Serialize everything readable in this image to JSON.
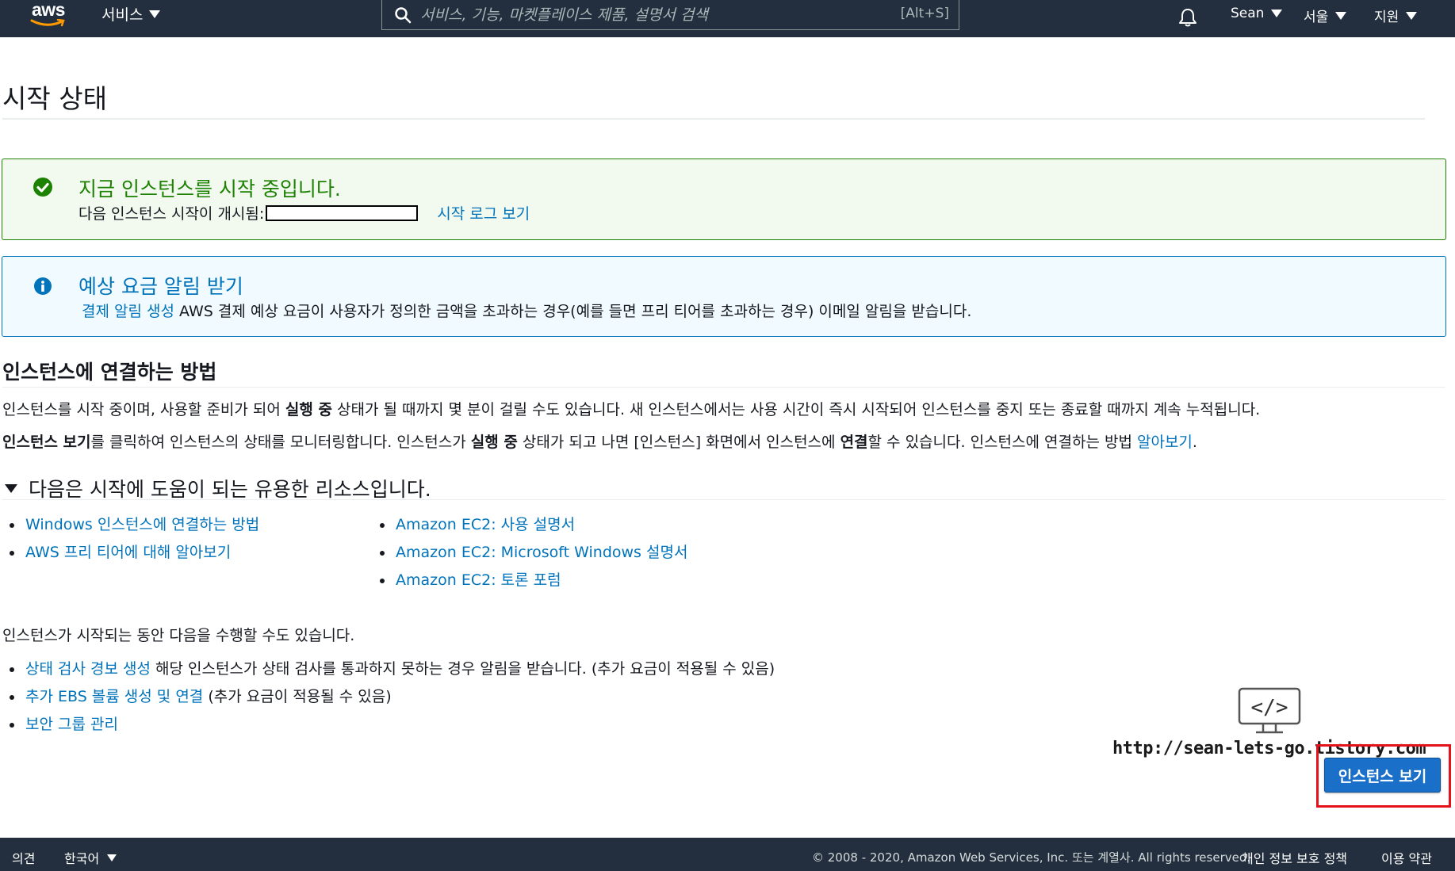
{
  "topnav": {
    "logo_text": "aws",
    "services_label": "서비스",
    "search_placeholder": "서비스, 기능, 마켓플레이스 제품, 설명서 검색",
    "search_shortcut": "[Alt+S]",
    "user_label": "Sean",
    "region_label": "서울",
    "support_label": "지원",
    "colors": {
      "background": "#232f3e",
      "logo_smile": "#ff9900"
    }
  },
  "page": {
    "title": "시작 상태"
  },
  "success_alert": {
    "title": "지금 인스턴스를 시작 중입니다.",
    "line_prefix": "다음 인스턴스 시작이 개시됨:",
    "log_link": "시작 로그 보기",
    "color": "#1d8102"
  },
  "info_alert": {
    "title": "예상 요금 알림 받기",
    "link": "결제 알림 생성",
    "text": " AWS 결제 예상 요금이 사용자가 정의한 금액을 초과하는 경우(예를 들면 프리 티어를 초과하는 경우) 이메일 알림을 받습니다.",
    "color": "#0073bb"
  },
  "connect_section": {
    "heading": "인스턴스에 연결하는 방법",
    "para1_a": "인스턴스를 시작 중이며, 사용할 준비가 되어 ",
    "para1_b": "실행 중",
    "para1_c": " 상태가 될 때까지 몇 분이 걸릴 수도 있습니다. 새 인스턴스에서는 사용 시간이 즉시 시작되어 인스턴스를 중지 또는 종료할 때까지 계속 누적됩니다.",
    "para2_a": "인스턴스 보기",
    "para2_b": "를 클릭하여 인스턴스의 상태를 모니터링합니다. 인스턴스가 ",
    "para2_c": "실행 중",
    "para2_d": " 상태가 되고 나면 [인스턴스] 화면에서 인스턴스에 ",
    "para2_e": "연결",
    "para2_f": "할 수 있습니다. 인스턴스에 연결하는 방법 ",
    "para2_link": "알아보기",
    "para2_end": "."
  },
  "resources": {
    "heading": "다음은 시작에 도움이 되는 유용한 리소스입니다.",
    "left_links": [
      "Windows 인스턴스에 연결하는 방법",
      "AWS 프리 티어에 대해 알아보기"
    ],
    "right_links": [
      "Amazon EC2: 사용 설명서",
      "Amazon EC2: Microsoft Windows 설명서",
      "Amazon EC2: 토론 포럼"
    ]
  },
  "while_starting": {
    "intro": "인스턴스가 시작되는 동안 다음을 수행할 수도 있습니다.",
    "items": [
      {
        "link": "상태 검사 경보 생성",
        "text": " 해당 인스턴스가 상태 검사를 통과하지 못하는 경우 알림을 받습니다. (추가 요금이 적용될 수 있음)"
      },
      {
        "link": "추가 EBS 볼륨 생성 및 연결",
        "text": " (추가 요금이 적용될 수 있음)"
      },
      {
        "link": "보안 그룹 관리",
        "text": ""
      }
    ]
  },
  "watermark": {
    "icon_text": "</>",
    "url": "http://sean-lets-go.tistory.com"
  },
  "actions": {
    "view_instances": "인스턴스 보기",
    "button_color": "#1a6fc9",
    "highlight_color": "#e3121b"
  },
  "footer": {
    "feedback": "의견",
    "language": "한국어",
    "copyright": "© 2008 - 2020, Amazon Web Services, Inc. 또는 계열사. All rights reserved.",
    "privacy": "개인 정보 보호 정책",
    "terms": "이용 약관"
  }
}
